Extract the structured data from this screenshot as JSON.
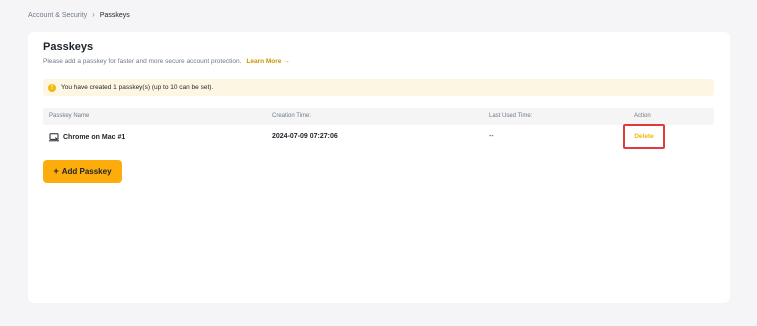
{
  "breadcrumb": {
    "parent": "Account & Security",
    "separator_icon": "chevron-right-icon",
    "current": "Passkeys"
  },
  "page": {
    "title": "Passkeys",
    "description": "Please add a passkey for faster and more secure account protection.",
    "learn_more": "Learn More"
  },
  "notice": {
    "icon": "warning-icon",
    "text": "You have created 1 passkey(s) (up to 10 can be set)."
  },
  "table": {
    "headers": {
      "name": "Passkey Name",
      "created": "Creation Time:",
      "last_used": "Last Used Time:",
      "action": "Action"
    },
    "rows": [
      {
        "icon": "laptop-icon",
        "name": "Chrome on Mac #1",
        "created": "2024-07-09 07:27:06",
        "last_used": "--",
        "action": "Delete"
      }
    ]
  },
  "add_button": {
    "icon": "plus-icon",
    "label": "Add Passkey"
  },
  "colors": {
    "accent": "#fcad0c",
    "link": "#c99400",
    "highlight_border": "#e03b3b",
    "notice_bg": "#fdf6e3"
  }
}
